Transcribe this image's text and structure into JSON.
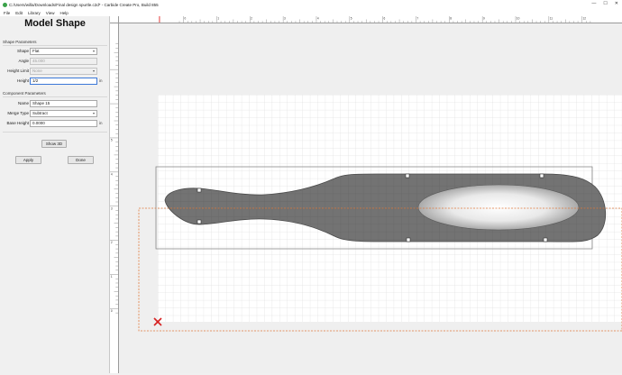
{
  "window": {
    "title": "C:/Users/willa/Downloads/Final design spurtle.c2d* - Carbide Create Pro, Build 855",
    "controls": [
      "—",
      "☐",
      "✕"
    ]
  },
  "menu": [
    {
      "label": "File"
    },
    {
      "label": "Edit"
    },
    {
      "label": "Library"
    },
    {
      "label": "View"
    },
    {
      "label": "Help"
    }
  ],
  "panel": {
    "title": "Model Shape",
    "shape_parameters": {
      "heading": "Shape Parameters",
      "shape_label": "Shape",
      "shape_value": "Flat",
      "angle_label": "Angle",
      "angle_value": "45.000",
      "height_limit_label": "Height Limit",
      "height_limit_value": "None",
      "height_label": "Height",
      "height_value": "1/2",
      "height_unit": "in"
    },
    "component_parameters": {
      "heading": "Component Parameters",
      "name_label": "Name",
      "name_value": "Shape 15",
      "merge_type_label": "Merge Type",
      "merge_type_value": "Subtract",
      "base_height_label": "Base Height",
      "base_height_value": "0.0000",
      "base_height_unit": "in"
    },
    "show_3d_label": "Show 3D",
    "apply_label": "Apply",
    "done_label": "Done"
  },
  "rulers": {
    "top_ticks": [
      "0",
      "1",
      "2",
      "3",
      "4",
      "5",
      "6",
      "7",
      "8",
      "9",
      "10",
      "11",
      "12"
    ],
    "left_ticks": [
      "5",
      "4",
      "3",
      "2",
      "1",
      "0"
    ]
  },
  "colors": {
    "shape_fill": "#737373",
    "selection_dash": "#e07a3c",
    "stock_border": "#8a8a8a",
    "origin_marker": "#d62020"
  }
}
